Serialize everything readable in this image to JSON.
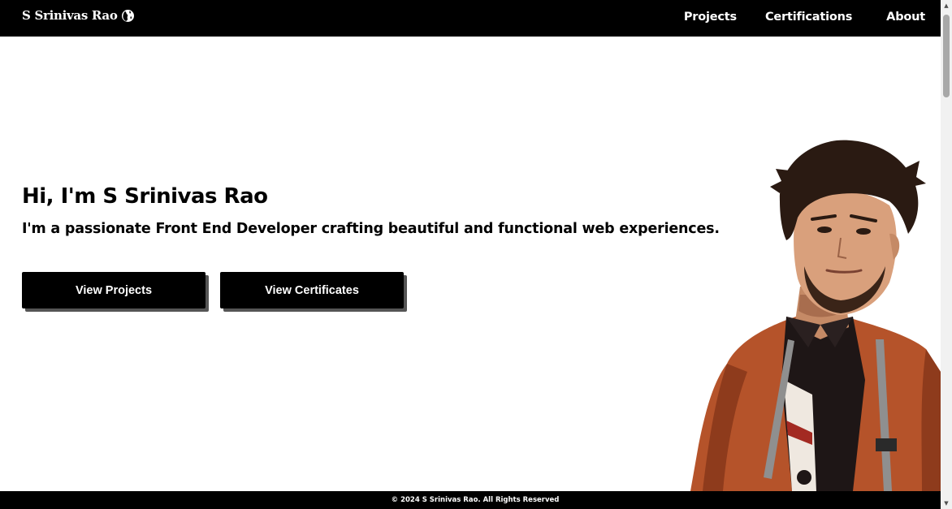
{
  "navbar": {
    "brand": "S Srinivas Rao",
    "brand_icon": "globe-icon",
    "links": [
      {
        "label": "Projects"
      },
      {
        "label": "Certifications"
      },
      {
        "label": "About"
      }
    ]
  },
  "hero": {
    "title": "Hi, I'm S Srinivas Rao",
    "subtitle": "I'm a passionate Front End Developer crafting beautiful and functional web experiences.",
    "buttons": {
      "projects": "View Projects",
      "certificates": "View Certificates"
    }
  },
  "footer": {
    "text": "© 2024 S Srinivas Rao. All Rights Reserved"
  },
  "colors": {
    "nav_bg": "#000000",
    "button_bg": "#000000",
    "button_shadow": "#555555",
    "jacket": "#b5532a",
    "background": "#ffffff"
  }
}
